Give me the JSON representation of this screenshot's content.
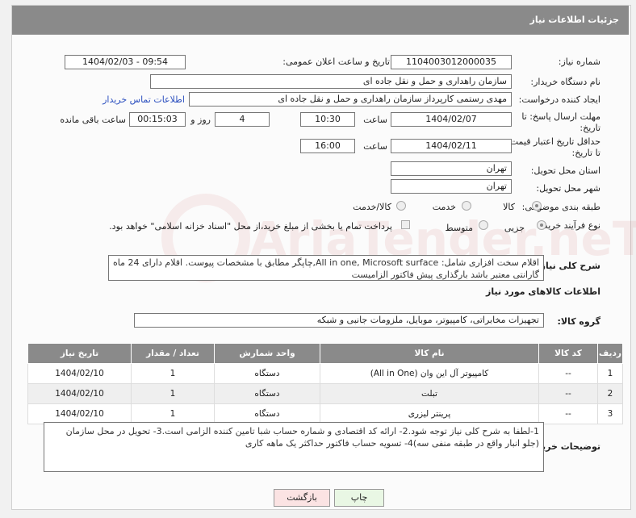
{
  "header": {
    "title": "جزئیات اطلاعات نیاز"
  },
  "fields": {
    "need_number_label": "شماره نیاز:",
    "need_number": "1104003012000035",
    "announce_label": "تاریخ و ساعت اعلان عمومی:",
    "announce_value": "1404/02/03 - 09:54",
    "buyer_org_label": "نام دستگاه خریدار:",
    "buyer_org": "سازمان راهداری و حمل و نقل جاده ای",
    "creator_label": "ایجاد کننده درخواست:",
    "creator": "مهدی رستمی کارپرداز سازمان راهداری و حمل و نقل جاده ای",
    "contact_link": "اطلاعات تماس خریدار",
    "deadline_label_1": "مهلت ارسال پاسخ: تا",
    "deadline_label_2": "تاریخ:",
    "deadline_date": "1404/02/07",
    "time_label": "ساعت",
    "deadline_time": "10:30",
    "days": "4",
    "days_label": "روز و",
    "remaining": "00:15:03",
    "remaining_label": "ساعت باقی مانده",
    "validity_label_1": "حداقل تاریخ اعتبار قیمت:",
    "validity_label_2": "تا تاریخ:",
    "validity_date": "1404/02/11",
    "validity_time": "16:00",
    "province_label": "استان محل تحویل:",
    "province": "تهران",
    "city_label": "شهر محل تحویل:",
    "city": "تهران",
    "category_label": "طبقه بندی موضوعی:",
    "category_options": [
      "کالا",
      "خدمت",
      "کالا/خدمت"
    ],
    "process_label": "نوع فرآیند خرید :",
    "process_options": [
      "جزیی",
      "متوسط"
    ],
    "payment_note": "پرداخت تمام یا بخشی از مبلغ خرید،از محل \"اسناد خزانه اسلامی\" خواهد بود."
  },
  "summary": {
    "label": "شرح کلی نیاز:",
    "text": "اقلام سخت افزاری شامل: All in one, Microsoft surface,چاپگر مطابق با مشخصات پیوست. اقلام دارای 24 ماه گارانتی معتبر باشد بارگذاری پیش فاکتور الزامیست"
  },
  "goods_section_title": "اطلاعات کالاهای مورد نیاز",
  "goods_group_label": "گروه کالا:",
  "goods_group": "تجهیزات مخابراتی، کامپیوتر، موبایل، ملزومات جانبی و شبکه",
  "table": {
    "headers": [
      "ردیف",
      "کد کالا",
      "نام کالا",
      "واحد شمارش",
      "تعداد / مقدار",
      "تاریخ نیاز"
    ],
    "rows": [
      [
        "1",
        "--",
        "کامپیوتر آل این وان (All in One)",
        "دستگاه",
        "1",
        "1404/02/10"
      ],
      [
        "2",
        "--",
        "تبلت",
        "دستگاه",
        "1",
        "1404/02/10"
      ],
      [
        "3",
        "--",
        "پرینتر لیزری",
        "دستگاه",
        "1",
        "1404/02/10"
      ]
    ]
  },
  "buyer_notes": {
    "label": "توضیحات خریدار:",
    "text": "1-لطفا به شرح کلی نیاز توجه شود.2- ارائه کد اقتصادی و شماره حساب شبا تامین کننده الزامی است.3- تحویل در محل سازمان (جلو انبار واقع در طبقه منفی سه)4- تسویه حساب فاکتور حداکثر یک ماهه کاری"
  },
  "buttons": {
    "print": "چاپ",
    "back": "بازگشت"
  },
  "watermark": "AriaTender.neT"
}
